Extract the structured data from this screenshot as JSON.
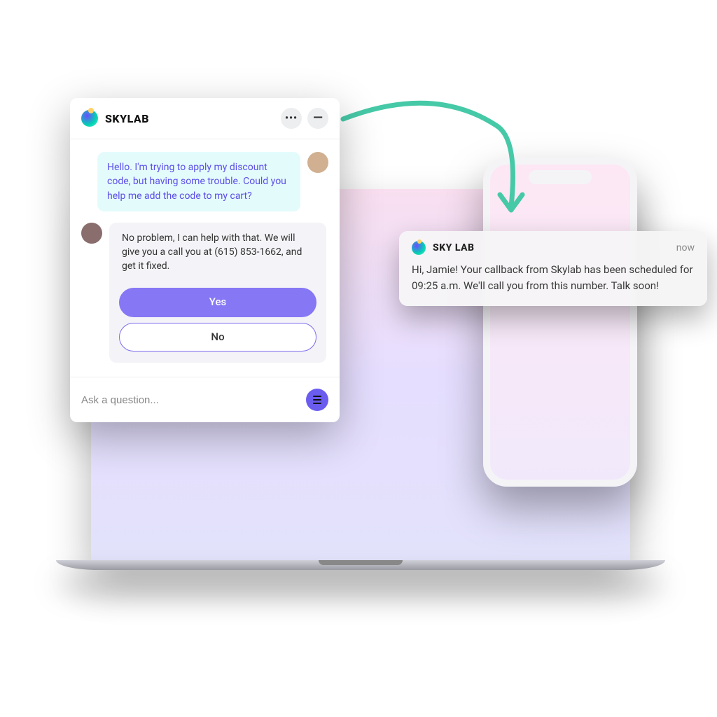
{
  "chat": {
    "brand": "SKYLAB",
    "user_message": "Hello. I'm trying to apply my discount code, but having some trouble. Could you help me add the code to my cart?",
    "agent_message": "No problem, I can help with that. We will give you a call you at (615) 853-1662, and get it fixed.",
    "yes_label": "Yes",
    "no_label": "No",
    "input_placeholder": "Ask a question..."
  },
  "notification": {
    "app": "SKY LAB",
    "time": "now",
    "body": "Hi, Jamie! Your callback from Skylab has been scheduled for 09:25 a.m. We'll call you from this number. Talk soon!"
  }
}
